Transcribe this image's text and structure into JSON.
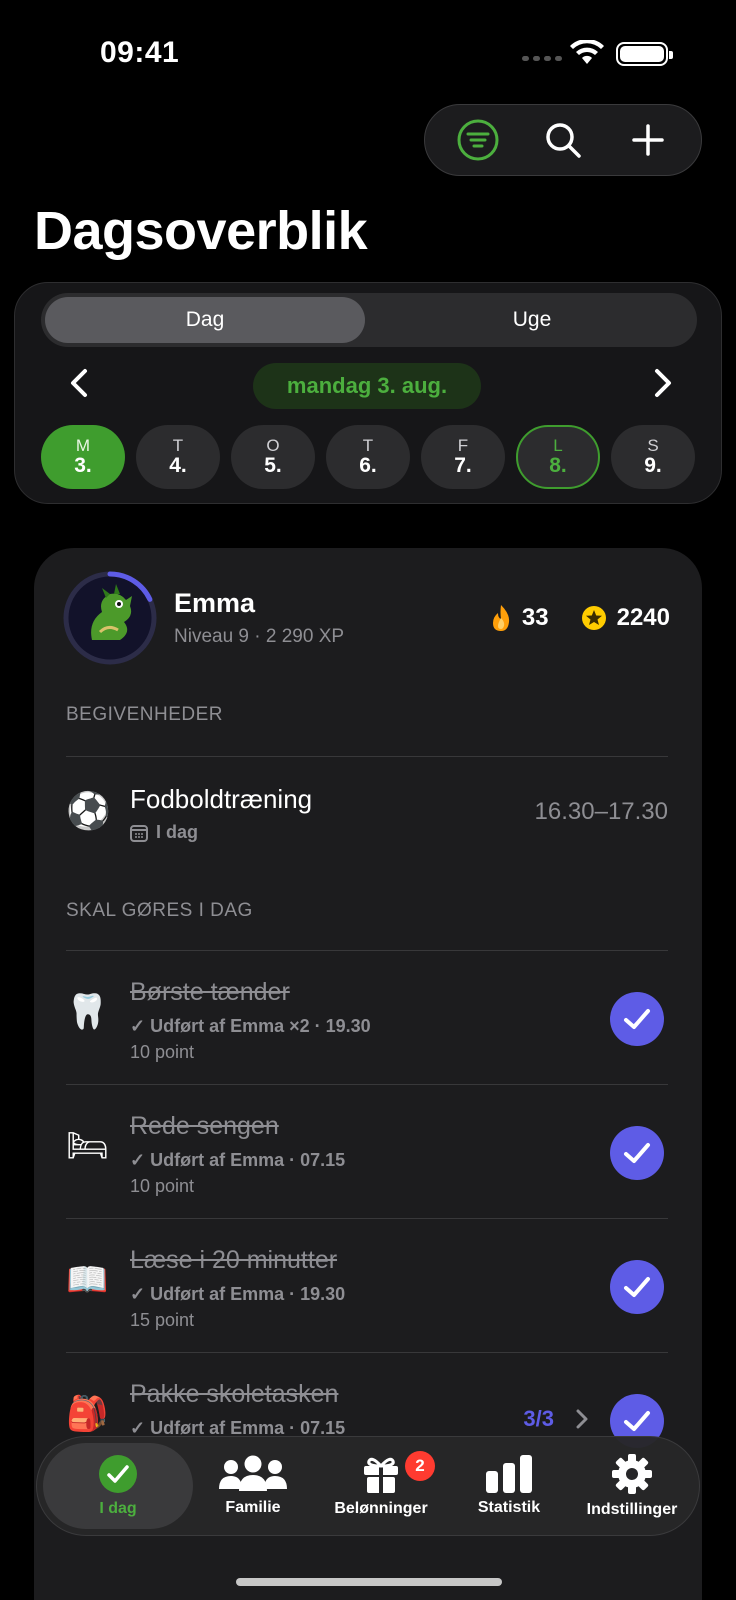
{
  "status_bar": {
    "time": "09:41"
  },
  "page_title": "Dagsoverblik",
  "view_toggle": {
    "day": "Dag",
    "week": "Uge"
  },
  "current_date": "mandag 3. aug.",
  "week_days": [
    {
      "letter": "M",
      "number": "3."
    },
    {
      "letter": "T",
      "number": "4."
    },
    {
      "letter": "O",
      "number": "5."
    },
    {
      "letter": "T",
      "number": "6."
    },
    {
      "letter": "F",
      "number": "7."
    },
    {
      "letter": "L",
      "number": "8."
    },
    {
      "letter": "S",
      "number": "9."
    }
  ],
  "profile": {
    "name": "Emma",
    "level": "Niveau 9 · 2 290 XP",
    "streak": "33",
    "coins": "2240",
    "level_progress": 0.18,
    "avatar_icon": "dragon"
  },
  "events_header": "BEGIVENHEDER",
  "events": [
    {
      "icon": "⚽",
      "title": "Fodboldtræning",
      "sub": "I dag",
      "time": "16.30–17.30"
    }
  ],
  "tasks_header": "SKAL GØRES I DAG",
  "tasks": [
    {
      "icon": "🦷",
      "title": "Børste tænder",
      "done": "✓ Udført af Emma ×2 · 19.30",
      "points": "10 point"
    },
    {
      "icon": "🛏",
      "title": "Rede sengen",
      "done": "✓ Udført af Emma · 07.15",
      "points": "10 point"
    },
    {
      "icon": "📖",
      "title": "Læse i 20 minutter",
      "done": "✓ Udført af Emma · 19.30",
      "points": "15 point"
    },
    {
      "icon": "🎒",
      "title": "Pakke skoletasken",
      "done": "✓ Udført af Emma · 07.15",
      "points": "",
      "count": "3/3"
    }
  ],
  "tabs": [
    {
      "label": "I dag"
    },
    {
      "label": "Familie"
    },
    {
      "label": "Belønninger",
      "badge": "2"
    },
    {
      "label": "Statistik"
    },
    {
      "label": "Indstillinger"
    }
  ],
  "colors": {
    "accent_green": "#3f9d2e",
    "accent_purple": "#5e5ce6",
    "background": "#000000",
    "card": "#1c1c1e"
  }
}
